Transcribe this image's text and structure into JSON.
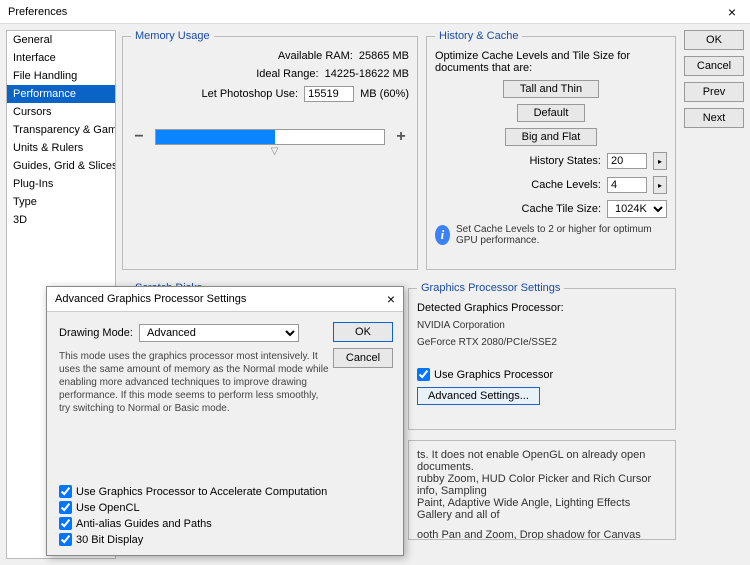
{
  "window": {
    "title": "Preferences",
    "close": "×"
  },
  "sidebar": {
    "items": [
      {
        "label": "General"
      },
      {
        "label": "Interface"
      },
      {
        "label": "File Handling"
      },
      {
        "label": "Performance"
      },
      {
        "label": "Cursors"
      },
      {
        "label": "Transparency & Gamut"
      },
      {
        "label": "Units & Rulers"
      },
      {
        "label": "Guides, Grid & Slices"
      },
      {
        "label": "Plug-Ins"
      },
      {
        "label": "Type"
      },
      {
        "label": "3D"
      }
    ],
    "selected": 3
  },
  "buttons": {
    "ok": "OK",
    "cancel": "Cancel",
    "prev": "Prev",
    "next": "Next"
  },
  "memory": {
    "legend": "Memory Usage",
    "available_label": "Available RAM:",
    "available_value": "25865 MB",
    "ideal_label": "Ideal Range:",
    "ideal_value": "14225-18622 MB",
    "let_label": "Let Photoshop Use:",
    "let_value": "15519",
    "let_suffix": "MB (60%)",
    "minus": "−",
    "plus": "+"
  },
  "history": {
    "legend": "History & Cache",
    "intro": "Optimize Cache Levels and Tile Size for documents that are:",
    "tall": "Tall and Thin",
    "default": "Default",
    "big": "Big and Flat",
    "states_label": "History States:",
    "states_value": "20",
    "levels_label": "Cache Levels:",
    "levels_value": "4",
    "tile_label": "Cache Tile Size:",
    "tile_value": "1024K",
    "tip": "Set Cache Levels to 2 or higher for optimum GPU performance."
  },
  "scratch": {
    "legend": "Scratch Disks"
  },
  "gpu": {
    "legend": "Graphics Processor Settings",
    "detected_label": "Detected Graphics Processor:",
    "vendor": "NVIDIA Corporation",
    "model": "GeForce RTX 2080/PCIe/SSE2",
    "use_cb": "Use Graphics Processor",
    "adv_btn": "Advanced Settings..."
  },
  "desc": {
    "line1": "ts. It does not enable OpenGL on already open documents.",
    "line2": "rubby Zoom, HUD Color Picker and Rich Cursor info, Sampling",
    "line3": "Paint, Adaptive Wide Angle, Lighting Effects Gallery and all of",
    "line4": "ooth Pan and Zoom, Drop shadow for Canvas Border, Painting"
  },
  "modal": {
    "title": "Advanced Graphics Processor Settings",
    "close": "×",
    "ok": "OK",
    "cancel": "Cancel",
    "mode_label": "Drawing Mode:",
    "mode_value": "Advanced",
    "desc": "This mode uses the graphics processor most intensively.  It uses the same amount of memory as the Normal mode while enabling more advanced techniques to improve drawing performance.  If this mode seems to perform less smoothly, try switching to Normal or Basic mode.",
    "cb1": "Use Graphics Processor to Accelerate Computation",
    "cb2": "Use OpenCL",
    "cb3": "Anti-alias Guides and Paths",
    "cb4": "30 Bit Display"
  }
}
